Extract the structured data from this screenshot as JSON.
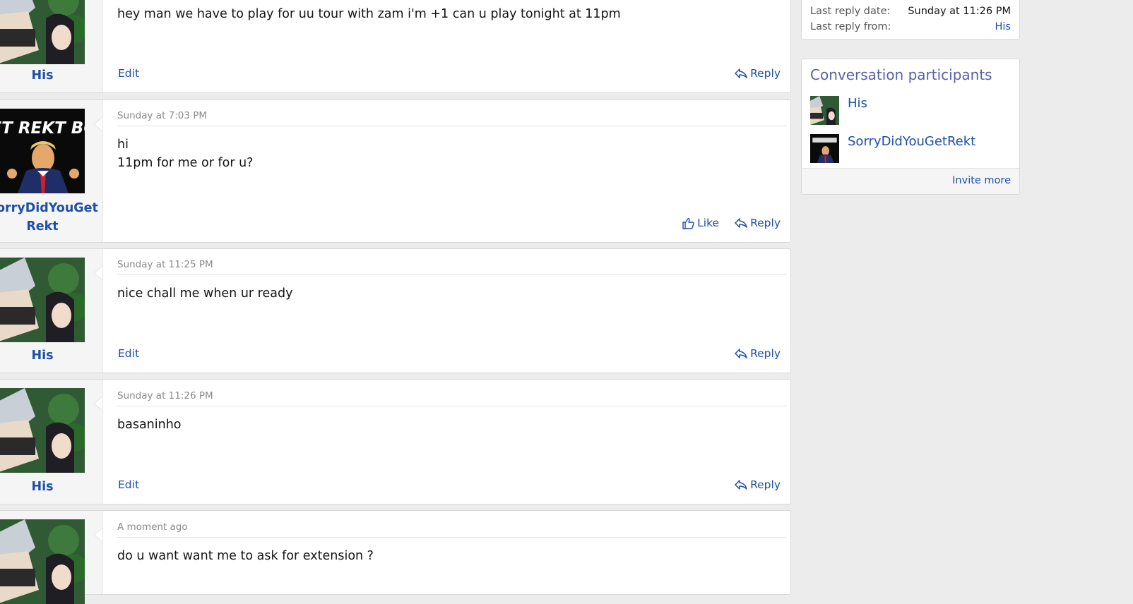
{
  "messages": [
    {
      "user": "His",
      "date": "",
      "text": "hey man we have to play for uu tour with zam i'm +1 can u play tonight at 11pm",
      "edit_label": "Edit",
      "like_label": "",
      "reply_label": "Reply"
    },
    {
      "user": "SorryDidYouGetRekt",
      "user_display": "orryDidYouGet\nRekt",
      "avatar_caption": "GET REKT BOI",
      "date": "Sunday at 7:03 PM",
      "text": "hi\n11pm for me or for u?",
      "like_label": "Like",
      "reply_label": "Reply"
    },
    {
      "user": "His",
      "date": "Sunday at 11:25 PM",
      "text": "nice chall me when ur ready",
      "edit_label": "Edit",
      "reply_label": "Reply"
    },
    {
      "user": "His",
      "date": "Sunday at 11:26 PM",
      "text": "basaninho",
      "edit_label": "Edit",
      "reply_label": "Reply"
    },
    {
      "user": "His",
      "date": "A moment ago",
      "text": "do u want want me to ask for extension ?"
    }
  ],
  "sidebar": {
    "info": {
      "last_reply_date_label": "Last reply date:",
      "last_reply_date_value": "Sunday at 11:26 PM",
      "last_reply_from_label": "Last reply from:",
      "last_reply_from_value": "His"
    },
    "participants": {
      "title": "Conversation participants",
      "items": [
        {
          "name": "His"
        },
        {
          "name": "SorryDidYouGetRekt"
        }
      ],
      "invite_label": "Invite more"
    }
  },
  "colors": {
    "link": "#1c4fa8",
    "title": "#5a5fa8",
    "background": "#ececec"
  }
}
